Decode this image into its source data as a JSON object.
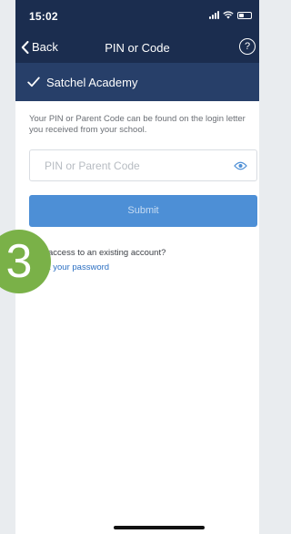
{
  "status": {
    "time": "15:02"
  },
  "nav": {
    "back_label": "Back",
    "title": "PIN or Code"
  },
  "school": {
    "name": "Satchel Academy"
  },
  "form": {
    "info_text": "Your PIN or Parent Code can be found on the login letter you received from your school.",
    "pin_placeholder": "PIN or Parent Code",
    "pin_value": "",
    "submit_label": "Submit"
  },
  "footer": {
    "access_text": "access to an existing account?",
    "forgot_link": "t your password"
  },
  "step_badge": "3",
  "icons": {
    "back": "chevron-left-icon",
    "help": "question-circle-icon",
    "check": "check-icon",
    "eye": "eye-icon",
    "signal": "signal-icon",
    "wifi": "wifi-icon",
    "battery": "battery-icon"
  },
  "colors": {
    "header_bg": "#1b2d4f",
    "school_bar_bg": "#273f69",
    "submit_bg": "#4d8fd6",
    "link": "#2b6fc2",
    "step_badge_bg": "#7ab148"
  }
}
